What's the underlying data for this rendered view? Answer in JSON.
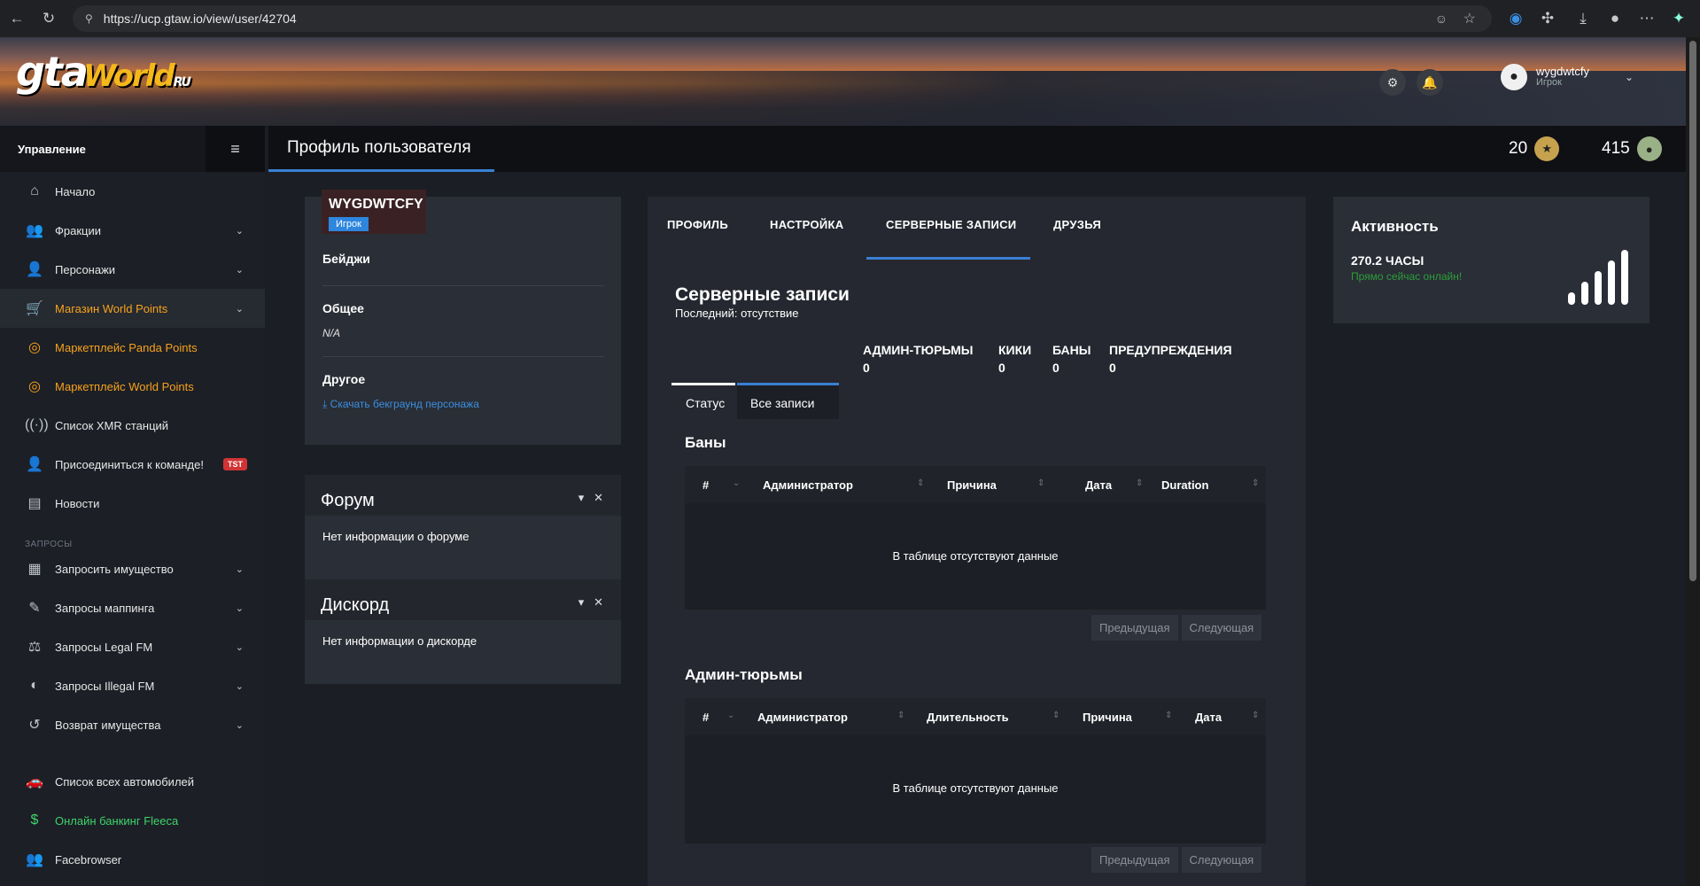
{
  "browser": {
    "url": "https://ucp.gtaw.io/view/user/42704"
  },
  "header": {
    "logo_main": "gta",
    "logo_world": "World",
    "logo_ru": "RU",
    "username": "wygdwtcfy",
    "user_role": "Игрок"
  },
  "sidebar": {
    "title": "Управление",
    "items": [
      {
        "label": "Начало"
      },
      {
        "label": "Фракции"
      },
      {
        "label": "Персонажи"
      },
      {
        "label": "Магазин World Points"
      },
      {
        "label": "Маркетплейс Panda Points"
      },
      {
        "label": "Маркетплейс World Points"
      },
      {
        "label": "Список XMR станций"
      },
      {
        "label": "Присоединиться к команде!",
        "badge": "TST"
      },
      {
        "label": "Новости"
      }
    ],
    "section": "ЗАПРОСЫ",
    "items2": [
      {
        "label": "Запросить имущество"
      },
      {
        "label": "Запросы маппинга"
      },
      {
        "label": "Запросы Legal FM"
      },
      {
        "label": "Запросы Illegal FM"
      },
      {
        "label": "Возврат имущества"
      }
    ],
    "items3": [
      {
        "label": "Список всех автомобилей"
      },
      {
        "label": "Онлайн банкинг Fleeca"
      },
      {
        "label": "Facebrowser"
      }
    ]
  },
  "topbar": {
    "title": "Профиль пользователя",
    "points1": "20",
    "points2": "415"
  },
  "profile": {
    "name": "WYGDWTCFY",
    "role": "Игрок",
    "badges_label": "Бейджи",
    "general_label": "Общее",
    "general_value": "N/A",
    "other_label": "Другое",
    "download_link": "Скачать бекграунд персонажа"
  },
  "forum": {
    "title": "Форум",
    "content": "Нет информации о форуме"
  },
  "discord": {
    "title": "Дискорд",
    "content": "Нет информации о дискорде"
  },
  "tabs": [
    "ПРОФИЛЬ",
    "НАСТРОЙКА",
    "СЕРВЕРНЫЕ ЗАПИСИ",
    "ДРУЗЬЯ"
  ],
  "records": {
    "title": "Серверные записи",
    "last": "Последний: отсутствие",
    "stats": [
      {
        "label": "АДМИН-ТЮРЬМЫ",
        "value": "0"
      },
      {
        "label": "КИКИ",
        "value": "0"
      },
      {
        "label": "БАНЫ",
        "value": "0"
      },
      {
        "label": "ПРЕДУПРЕЖДЕНИЯ",
        "value": "0"
      }
    ],
    "subtabs": [
      "Статус",
      "Все записи"
    ],
    "bans": {
      "title": "Баны",
      "columns": [
        "#",
        "Администратор",
        "Причина",
        "Дата",
        "Duration"
      ],
      "empty": "В таблице отсутствуют данные"
    },
    "jails": {
      "title": "Админ-тюрьмы",
      "columns": [
        "#",
        "Администратор",
        "Длительность",
        "Причина",
        "Дата"
      ],
      "empty": "В таблице отсутствуют данные"
    },
    "prev": "Предыдущая",
    "next": "Следующая"
  },
  "activity": {
    "title": "Активность",
    "hours": "270.2 ЧАСЫ",
    "online": "Прямо сейчас онлайн!"
  }
}
